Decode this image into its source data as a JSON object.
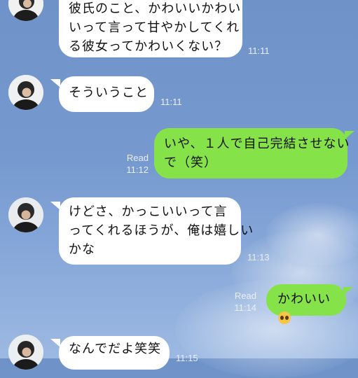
{
  "chat": {
    "messages": [
      {
        "side": "in",
        "lines": [
          "彼氏のこと、かわいいかわい",
          "いって言って甘やかしてくれ",
          "る彼女ってかわいくない？"
        ],
        "time": "11:11"
      },
      {
        "side": "in",
        "lines": [
          "そういうこと"
        ],
        "time": "11:11"
      },
      {
        "side": "out",
        "lines": [
          "いや、１人で自己完結させない",
          "で（笑）"
        ],
        "read": "Read",
        "time": "11:12"
      },
      {
        "side": "in",
        "lines": [
          "けどさ、かっこいいって言",
          "ってくれるほうが、俺は嬉しい",
          "かな"
        ],
        "time": "11:13"
      },
      {
        "side": "out",
        "lines": [
          "かわいい"
        ],
        "emoji": "pleading-face",
        "read": "Read",
        "time": "11:14"
      },
      {
        "side": "in",
        "lines": [
          "なんでだよ笑笑"
        ],
        "time": "11:15"
      }
    ]
  },
  "colors": {
    "background": "#7699cf",
    "incoming_bubble": "#ffffff",
    "outgoing_bubble": "#85e249",
    "meta_text": "#e9eef7"
  }
}
